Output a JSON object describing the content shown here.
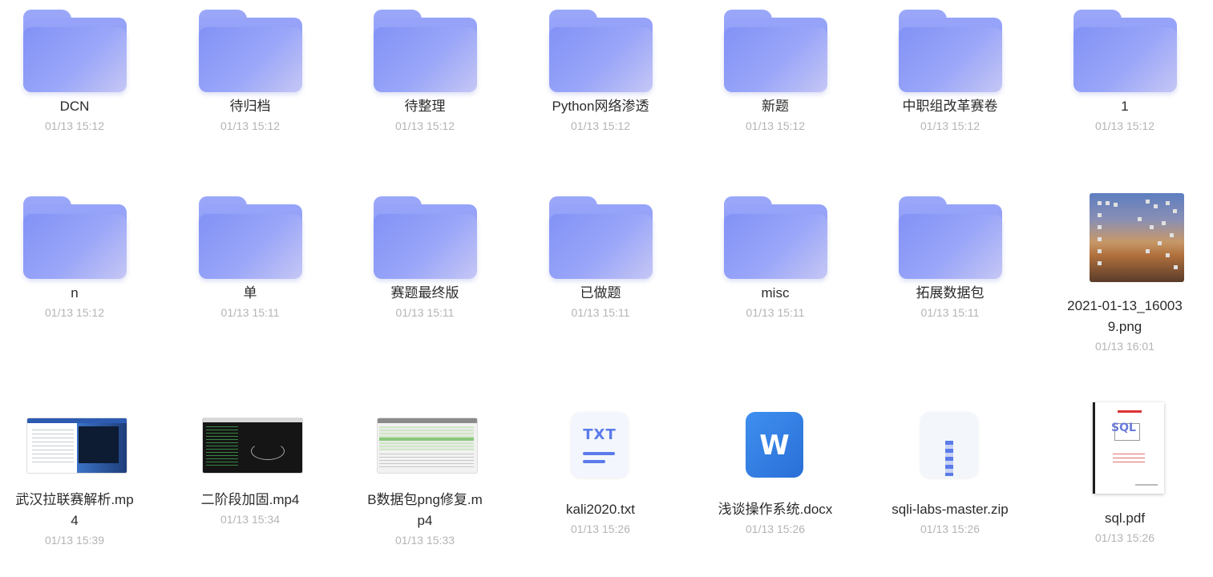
{
  "files": [
    {
      "name": "DCN",
      "date": "01/13 15:12",
      "type": "folder"
    },
    {
      "name": "待归档",
      "date": "01/13 15:12",
      "type": "folder"
    },
    {
      "name": "待整理",
      "date": "01/13 15:12",
      "type": "folder"
    },
    {
      "name": "Python网络渗透",
      "date": "01/13 15:12",
      "type": "folder"
    },
    {
      "name": "新题",
      "date": "01/13 15:12",
      "type": "folder"
    },
    {
      "name": "中职组改革赛卷",
      "date": "01/13 15:12",
      "type": "folder"
    },
    {
      "name": "1",
      "date": "01/13 15:12",
      "type": "folder"
    },
    {
      "name": "n",
      "date": "01/13 15:12",
      "type": "folder"
    },
    {
      "name": "单",
      "date": "01/13 15:11",
      "type": "folder"
    },
    {
      "name": "赛题最终版",
      "date": "01/13 15:11",
      "type": "folder"
    },
    {
      "name": "已做题",
      "date": "01/13 15:11",
      "type": "folder"
    },
    {
      "name": "misc",
      "date": "01/13 15:11",
      "type": "folder"
    },
    {
      "name": "拓展数据包",
      "date": "01/13 15:11",
      "type": "folder"
    },
    {
      "name": "2021-01-13_160039.png",
      "date": "01/13 16:01",
      "type": "image"
    },
    {
      "name": "武汉拉联赛解析.mp4",
      "date": "01/13 15:39",
      "type": "video"
    },
    {
      "name": "二阶段加固.mp4",
      "date": "01/13 15:34",
      "type": "video"
    },
    {
      "name": "B数据包png修复.mp4",
      "date": "01/13 15:33",
      "type": "video"
    },
    {
      "name": "kali2020.txt",
      "date": "01/13 15:26",
      "type": "txt"
    },
    {
      "name": "浅谈操作系统.docx",
      "date": "01/13 15:26",
      "type": "docx"
    },
    {
      "name": "sqli-labs-master.zip",
      "date": "01/13 15:26",
      "type": "zip"
    },
    {
      "name": "sql.pdf",
      "date": "01/13 15:26",
      "type": "pdf"
    }
  ],
  "icons": {
    "txt_label": "TXT",
    "docx_label": "W",
    "pdf_logo_text": "SQL"
  },
  "colors": {
    "folder_front": "#8292f6",
    "folder_back": "#96a3f8",
    "file_name": "#2b2b2b",
    "file_date": "#b4b4b4",
    "icon_accent": "#5b7bea",
    "word_blue": "#2a6fd6"
  }
}
